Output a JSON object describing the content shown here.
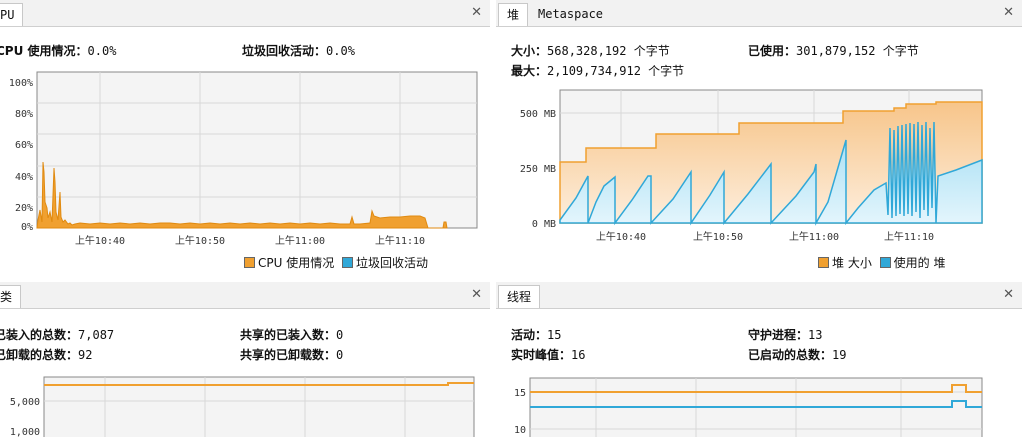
{
  "colors": {
    "orange": "#f0a030",
    "blue": "#30a8d8",
    "grid": "#d8d8d8",
    "plot_bg": "#f4f4f4"
  },
  "cpu": {
    "tab": "PU",
    "usage_label": "CPU 使用情况：",
    "usage_value": "0.0%",
    "gc_label": "垃圾回收活动：",
    "gc_value": "0.0%",
    "y_ticks": [
      "100%",
      "80%",
      "60%",
      "40%",
      "20%",
      "0%"
    ],
    "x_ticks": [
      "上午10:40",
      "上午10:50",
      "上午11:00",
      "上午11:10"
    ],
    "legend": [
      "CPU 使用情况",
      "垃圾回收活动"
    ]
  },
  "heap": {
    "tabs": [
      "堆",
      "Metaspace"
    ],
    "size_label": "大小：",
    "size_value": "568,328,192 个字节",
    "used_label": "已使用：",
    "used_value": "301,879,152 个字节",
    "max_label": "最大：",
    "max_value": "2,109,734,912 个字节",
    "y_ticks": [
      "500 MB",
      "250 MB",
      "0 MB"
    ],
    "x_ticks": [
      "上午10:40",
      "上午10:50",
      "上午11:00",
      "上午11:10"
    ],
    "legend": [
      "堆 大小",
      "使用的 堆"
    ]
  },
  "classes": {
    "tab": "类",
    "loaded_label": "已装入的总数：",
    "loaded_value": "7,087",
    "unloaded_label": "已卸载的总数：",
    "unloaded_value": "92",
    "shared_loaded_label": "共享的已装入数：",
    "shared_loaded_value": "0",
    "shared_unloaded_label": "共享的已卸载数：",
    "shared_unloaded_value": "0",
    "y_ticks": [
      "5,000",
      "1,000"
    ]
  },
  "threads": {
    "tab": "线程",
    "live_label": "活动：",
    "live_value": "15",
    "daemon_label": "守护进程：",
    "daemon_value": "13",
    "peak_label": "实时峰值：",
    "peak_value": "16",
    "started_label": "已启动的总数：",
    "started_value": "19",
    "y_ticks": [
      "15",
      "10"
    ]
  }
}
